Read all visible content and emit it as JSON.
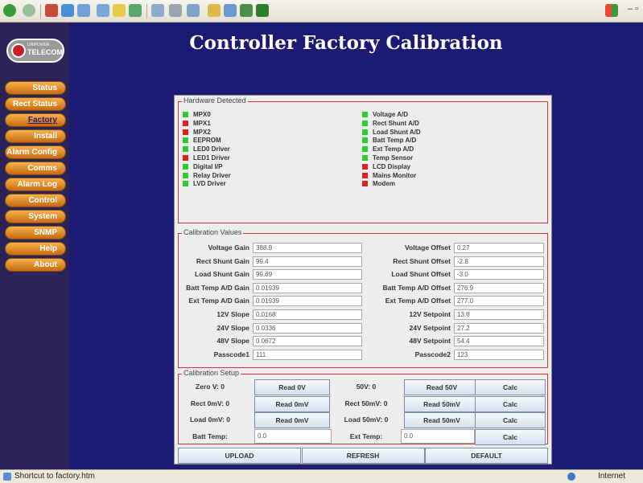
{
  "browser": {
    "status_text": "Shortcut to factory.htm",
    "zone_text": "Internet"
  },
  "logo": {
    "text_top": "UNIPOWER",
    "text": "TELECOM"
  },
  "nav": [
    {
      "label": "Status",
      "active": false
    },
    {
      "label": "Rect Status",
      "active": false
    },
    {
      "label": "Factory",
      "active": true
    },
    {
      "label": "Install",
      "active": false
    },
    {
      "label": "Alarm Config",
      "active": false
    },
    {
      "label": "Comms",
      "active": false
    },
    {
      "label": "Alarm Log",
      "active": false
    },
    {
      "label": "Control",
      "active": false
    },
    {
      "label": "System",
      "active": false
    },
    {
      "label": "SNMP",
      "active": false
    },
    {
      "label": "Help",
      "active": false
    },
    {
      "label": "About",
      "active": false
    }
  ],
  "page_title": "Controller Factory Calibration",
  "colors": {
    "ok": "#2ecc2e",
    "fault": "#dd2222",
    "group_border": "#cc3333"
  },
  "hardware": {
    "title": "Hardware Detected",
    "left": [
      {
        "label": "MPX0",
        "status": "ok"
      },
      {
        "label": "MPX1",
        "status": "fault"
      },
      {
        "label": "MPX2",
        "status": "fault"
      },
      {
        "label": "EEPROM",
        "status": "ok"
      },
      {
        "label": "LED0 Driver",
        "status": "ok"
      },
      {
        "label": "LED1 Driver",
        "status": "fault"
      },
      {
        "label": "Digital I/P",
        "status": "ok"
      },
      {
        "label": "Relay Driver",
        "status": "ok"
      },
      {
        "label": "LVD Driver",
        "status": "ok"
      }
    ],
    "right": [
      {
        "label": "Voltage A/D",
        "status": "ok"
      },
      {
        "label": "Rect Shunt A/D",
        "status": "ok"
      },
      {
        "label": "Load Shunt A/D",
        "status": "ok"
      },
      {
        "label": "Batt Temp A/D",
        "status": "ok"
      },
      {
        "label": "Ext Temp A/D",
        "status": "ok"
      },
      {
        "label": "Temp Sensor",
        "status": "ok"
      },
      {
        "label": "LCD Display",
        "status": "fault"
      },
      {
        "label": "Mains Monitor",
        "status": "fault"
      },
      {
        "label": "Modem",
        "status": "fault"
      }
    ]
  },
  "calibration_values": {
    "title": "Calibration Values",
    "rows": [
      {
        "l_label": "Voltage Gain",
        "l_value": "388.9",
        "r_label": "Voltage Offset",
        "r_value": "0.27"
      },
      {
        "l_label": "Rect Shunt Gain",
        "l_value": "99.4",
        "r_label": "Rect Shunt Offset",
        "r_value": "-2.8"
      },
      {
        "l_label": "Load Shunt Gain",
        "l_value": "99.69",
        "r_label": "Load Shunt Offset",
        "r_value": "-3.0"
      },
      {
        "l_label": "Batt Temp A/D Gain",
        "l_value": "0.01939",
        "r_label": "Batt Temp A/D Offset",
        "r_value": "276.9"
      },
      {
        "l_label": "Ext Temp A/D Gain",
        "l_value": "0.01939",
        "r_label": "Ext Temp A/D Offset",
        "r_value": "277.0"
      },
      {
        "l_label": "12V Slope",
        "l_value": "0.0168",
        "r_label": "12V Setpoint",
        "r_value": "13.6"
      },
      {
        "l_label": "24V Slope",
        "l_value": "0.0336",
        "r_label": "24V Setpoint",
        "r_value": "27.2"
      },
      {
        "l_label": "48V Slope",
        "l_value": "0.0672",
        "r_label": "48V Setpoint",
        "r_value": "54.4"
      },
      {
        "l_label": "Passcode1",
        "l_value": "111",
        "r_label": "Passcode2",
        "r_value": "123"
      }
    ]
  },
  "calibration_setup": {
    "title": "Calibration Setup",
    "rows": [
      {
        "l_label": "Zero V: 0",
        "l_button": "Read 0V",
        "r_label": "50V: 0",
        "r_button": "Read 50V",
        "calc": "Calc"
      },
      {
        "l_label": "Rect 0mV: 0",
        "l_button": "Read 0mV",
        "r_label": "Rect 50mV: 0",
        "r_button": "Read 50mV",
        "calc": "Calc"
      },
      {
        "l_label": "Load 0mV: 0",
        "l_button": "Read 0mV",
        "r_label": "Load 50mV: 0",
        "r_button": "Read 50mV",
        "calc": "Calc"
      }
    ],
    "temp_row": {
      "l_label": "Batt Temp:",
      "l_value": "0.0",
      "r_label": "Ext Temp:",
      "r_value": "0.0",
      "calc": "Calc"
    }
  },
  "actions": [
    {
      "label": "UPLOAD"
    },
    {
      "label": "REFRESH"
    },
    {
      "label": "DEFAULT"
    }
  ]
}
